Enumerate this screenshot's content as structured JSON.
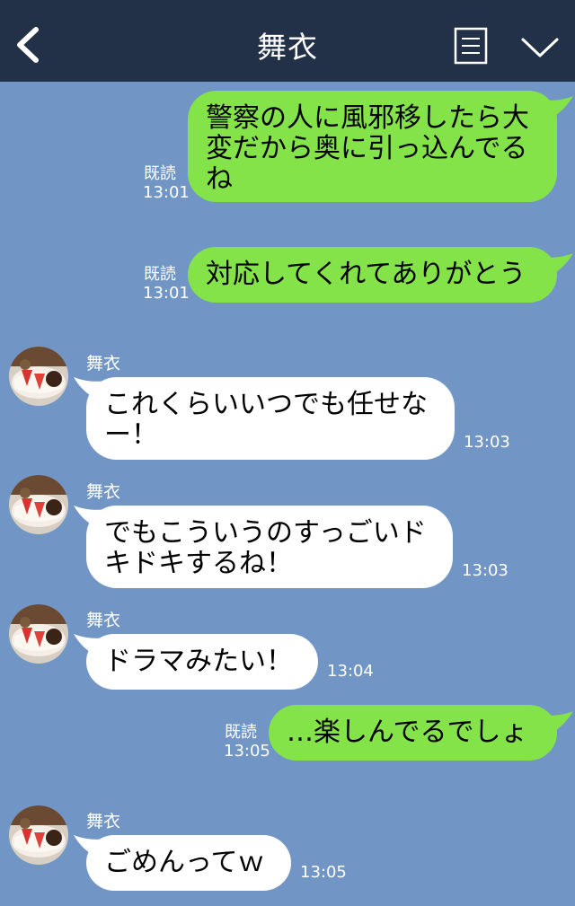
{
  "header": {
    "title": "舞衣"
  },
  "messages": [
    {
      "dir": "out",
      "text": "警察の人に風邪移したら大\n変だから奥に引っ込んでる\nね",
      "read": "既読",
      "time": "13:01"
    },
    {
      "dir": "out",
      "text": "対応してくれてありがとう",
      "read": "既読",
      "time": "13:01"
    },
    {
      "dir": "in",
      "sender": "舞衣",
      "text": "これくらいいつでも任せな\nー！",
      "time": "13:03"
    },
    {
      "dir": "in",
      "sender": "舞衣",
      "text": "でもこういうのすっごいド\nキドキするね！",
      "time": "13:03"
    },
    {
      "dir": "in",
      "sender": "舞衣",
      "text": "ドラマみたい！",
      "time": "13:04"
    },
    {
      "dir": "out",
      "text": "…楽しんでるでしょ",
      "read": "既読",
      "time": "13:05"
    },
    {
      "dir": "in",
      "sender": "舞衣",
      "text": "ごめんってｗ",
      "time": "13:05"
    }
  ],
  "colors": {
    "header_bg": "#233148",
    "chat_bg": "#7196c6",
    "outgoing_bubble": "#85e34a",
    "incoming_bubble": "#ffffff"
  },
  "icons": {
    "back": "back-chevron-icon",
    "menu": "memo-list-icon",
    "more": "chevron-down-icon",
    "avatar": "cake-avatar"
  }
}
